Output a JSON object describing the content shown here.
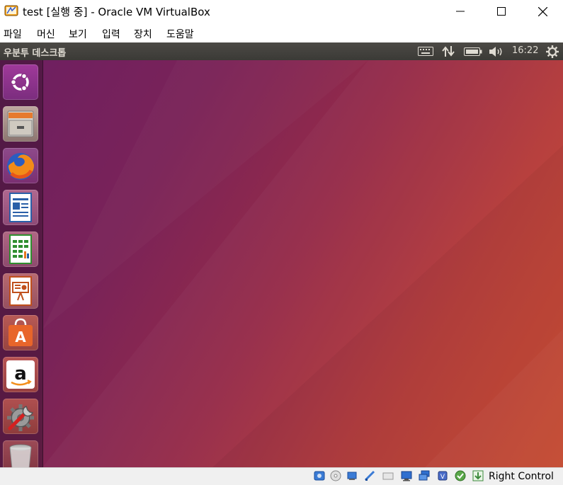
{
  "window": {
    "title": "test [실행 중] - Oracle VM VirtualBox",
    "app_icon": "virtualbox-icon",
    "controls": [
      "minimize-icon",
      "maximize-icon",
      "close-icon"
    ]
  },
  "menu": {
    "items": [
      "파일",
      "머신",
      "보기",
      "입력",
      "장치",
      "도움말"
    ]
  },
  "guest": {
    "panel": {
      "title": "우분투 데스크톱",
      "indicators": [
        "keyboard-icon",
        "network-updown-icon",
        "battery-icon",
        "volume-icon"
      ],
      "clock": "16:22",
      "session_icon": "gear-icon"
    },
    "launcher": {
      "items": [
        "ubuntu-dash-icon",
        "files-icon",
        "firefox-icon",
        "libreoffice-writer-icon",
        "libreoffice-calc-icon",
        "libreoffice-impress-icon",
        "ubuntu-software-icon",
        "amazon-icon",
        "system-settings-icon",
        "trash-icon"
      ]
    },
    "colors": {
      "wallpaper_start": "#6d1f62",
      "wallpaper_end": "#cc4a2e",
      "panel": "#3b3a36"
    }
  },
  "statusbar": {
    "icons": [
      "hard-disk-icon",
      "optical-drive-icon",
      "audio-icon",
      "network-icon",
      "usb-icon",
      "shared-folders-icon",
      "display-icon",
      "video-capture-icon",
      "cpu-virtualization-icon",
      "mouse-integration-icon",
      "download-icon"
    ],
    "host_key": "Right Control"
  }
}
